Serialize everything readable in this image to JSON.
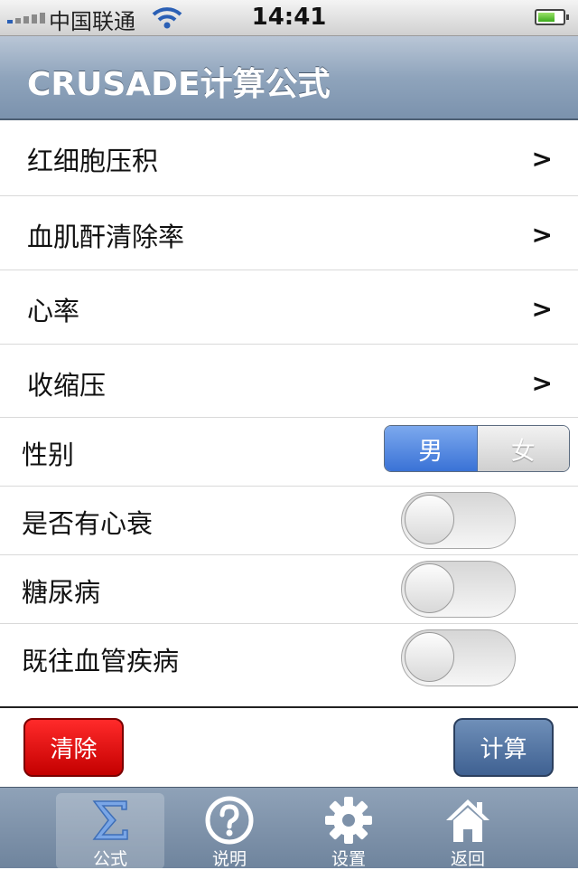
{
  "status_bar": {
    "carrier": "中国联通",
    "time": "14:41",
    "battery_level": 0.7
  },
  "nav": {
    "title": "CRUSADE计算公式"
  },
  "rows": [
    {
      "label": "红细胞压积",
      "chevron": ">"
    },
    {
      "label": "血肌酐清除率",
      "chevron": ">"
    },
    {
      "label": "心率",
      "chevron": ">"
    },
    {
      "label": "收缩压",
      "chevron": ">"
    }
  ],
  "gender": {
    "label": "性别",
    "options": [
      "男",
      "女"
    ],
    "selected": "男"
  },
  "toggles": [
    {
      "label": "是否有心衰",
      "on": false
    },
    {
      "label": "糖尿病",
      "on": false
    },
    {
      "label": "既往血管疾病",
      "on": false
    }
  ],
  "buttons": {
    "clear": "清除",
    "calculate": "计算"
  },
  "tab_bar": {
    "selected": "公式",
    "items": [
      {
        "label": "公式",
        "icon": "sigma-icon"
      },
      {
        "label": "说明",
        "icon": "question-circle-icon"
      },
      {
        "label": "设置",
        "icon": "gear-icon"
      },
      {
        "label": "返回",
        "icon": "home-icon"
      }
    ]
  },
  "colors": {
    "clear_button": "#d40000",
    "calculate_button": "#4f6f9f",
    "segment_selected": "#4a82e0"
  }
}
